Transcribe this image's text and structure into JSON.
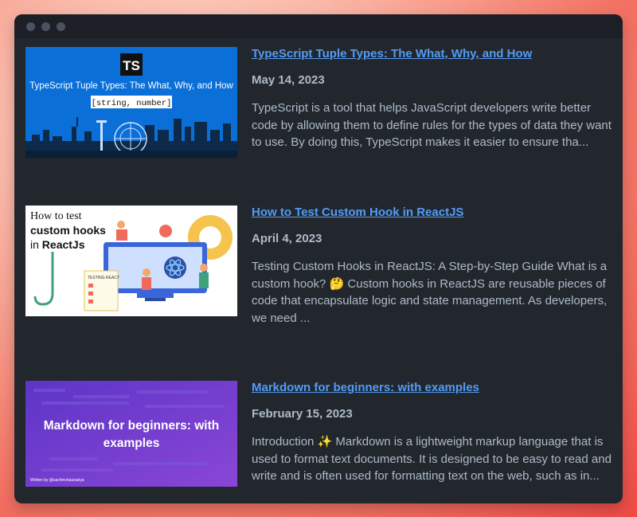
{
  "window": {
    "dots": [
      "close",
      "minimize",
      "maximize"
    ]
  },
  "posts": [
    {
      "title": "TypeScript Tuple Types: The What, Why, and How",
      "date": "May 14, 2023",
      "excerpt": "TypeScript is a tool that helps JavaScript developers write better code by allowing them to define rules for the types of data they want to use. By doing this, TypeScript makes it easier to ensure tha...",
      "thumb": {
        "logo": "TS",
        "heading": "TypeScript Tuple Types: The What, Why, and How",
        "code": "[string, number]"
      }
    },
    {
      "title": "How to Test Custom Hook in ReactJS",
      "date": "April 4, 2023",
      "excerpt": "Testing Custom Hooks in ReactJS: A Step-by-Step Guide What is a custom hook? 🤔 Custom hooks in ReactJS are reusable pieces of code that encapsulate logic and state management. As developers, we need ...",
      "thumb": {
        "line1": "How to test",
        "line2": "custom hooks",
        "line3_prefix": "in ",
        "line3_bold": "ReactJs",
        "badge": "TESTING REACT"
      }
    },
    {
      "title": "Markdown for beginners: with examples",
      "date": "February 15, 2023",
      "excerpt": "Introduction ✨ Markdown is a lightweight markup language that is used to format text documents. It is designed to be easy to read and write and is often used for formatting text on the web, such as in...",
      "thumb": {
        "heading": "Markdown for beginners: with examples",
        "credit": "Written by @sachinchaurasiya"
      }
    }
  ]
}
